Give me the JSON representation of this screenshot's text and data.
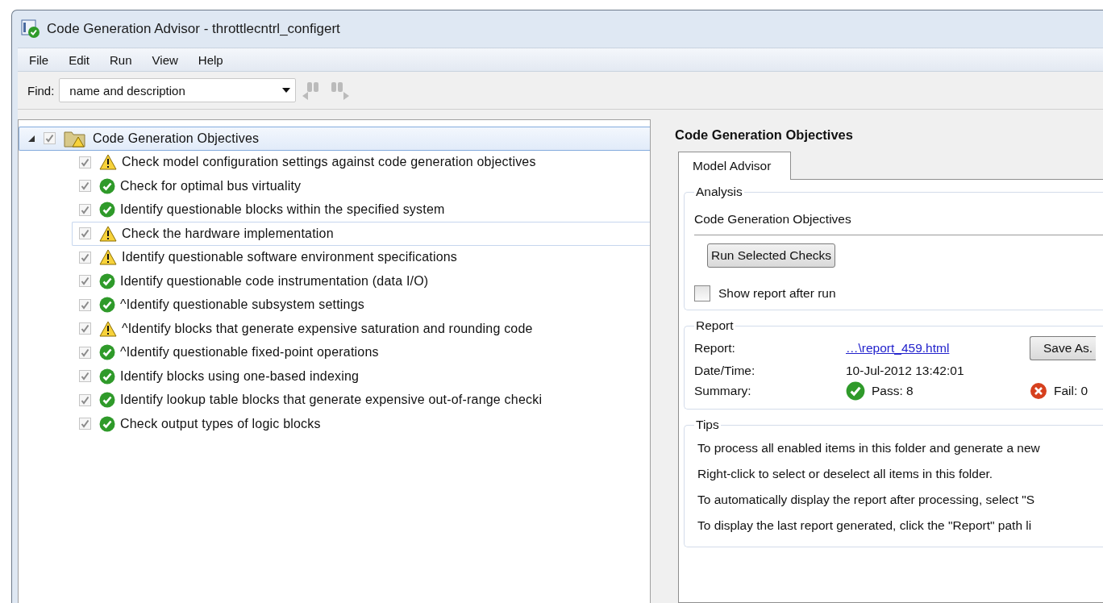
{
  "window": {
    "title": "Code Generation Advisor - throttlecntrl_configert"
  },
  "menu": [
    "File",
    "Edit",
    "Run",
    "View",
    "Help"
  ],
  "find": {
    "label": "Find:",
    "value": "name and description"
  },
  "tree": {
    "label": "Code Generation Objectives",
    "expanded": true,
    "checked": true,
    "selected": true,
    "kind": "folder-warning",
    "children": [
      {
        "label": "Check model configuration settings against code generation objectives",
        "checked": true,
        "selected": false,
        "hover": false,
        "kind": "warning"
      },
      {
        "label": "Check for optimal bus virtuality",
        "checked": true,
        "selected": false,
        "hover": false,
        "kind": "pass"
      },
      {
        "label": "Identify questionable blocks within the specified system",
        "checked": true,
        "selected": false,
        "hover": false,
        "kind": "pass"
      },
      {
        "label": "Check the hardware implementation",
        "checked": true,
        "selected": false,
        "hover": true,
        "kind": "warning"
      },
      {
        "label": "Identify questionable software environment specifications",
        "checked": true,
        "selected": false,
        "hover": false,
        "kind": "warning"
      },
      {
        "label": "Identify questionable code instrumentation (data I/O)",
        "checked": true,
        "selected": false,
        "hover": false,
        "kind": "pass"
      },
      {
        "label": "^Identify questionable subsystem settings",
        "checked": true,
        "selected": false,
        "hover": false,
        "kind": "pass"
      },
      {
        "label": "^Identify blocks that generate expensive saturation and rounding code",
        "checked": true,
        "selected": false,
        "hover": false,
        "kind": "warning"
      },
      {
        "label": "^Identify questionable fixed-point operations",
        "checked": true,
        "selected": false,
        "hover": false,
        "kind": "pass"
      },
      {
        "label": "Identify blocks using one-based indexing",
        "checked": true,
        "selected": false,
        "hover": false,
        "kind": "pass"
      },
      {
        "label": "Identify lookup table blocks that generate expensive out-of-range checki",
        "checked": true,
        "selected": false,
        "hover": false,
        "kind": "pass"
      },
      {
        "label": "Check output types of logic blocks",
        "checked": true,
        "selected": false,
        "hover": false,
        "kind": "pass"
      }
    ]
  },
  "detail": {
    "title": "Code Generation Objectives",
    "tabs": [
      {
        "label": "Model Advisor",
        "selected": true
      }
    ],
    "analysis": {
      "legend": "Analysis",
      "name": "Code Generation Objectives",
      "run_button": "Run Selected Checks",
      "show_report": {
        "label": "Show report after run",
        "checked": false
      }
    },
    "report": {
      "legend": "Report",
      "report_label": "Report:",
      "report_link": "…\\report_459.html",
      "save_button": "Save As.",
      "datetime_label": "Date/Time:",
      "datetime": "10-Jul-2012 13:42:01",
      "summary_label": "Summary:",
      "pass": "Pass: 8",
      "fail": "Fail: 0"
    },
    "tips": {
      "legend": "Tips",
      "lines": [
        "To process all enabled items in this folder and generate a new",
        "Right-click to select or deselect all items in this folder.",
        "To automatically display the report after processing, select \"S",
        "To display the last report generated, click the \"Report\" path li"
      ]
    }
  }
}
